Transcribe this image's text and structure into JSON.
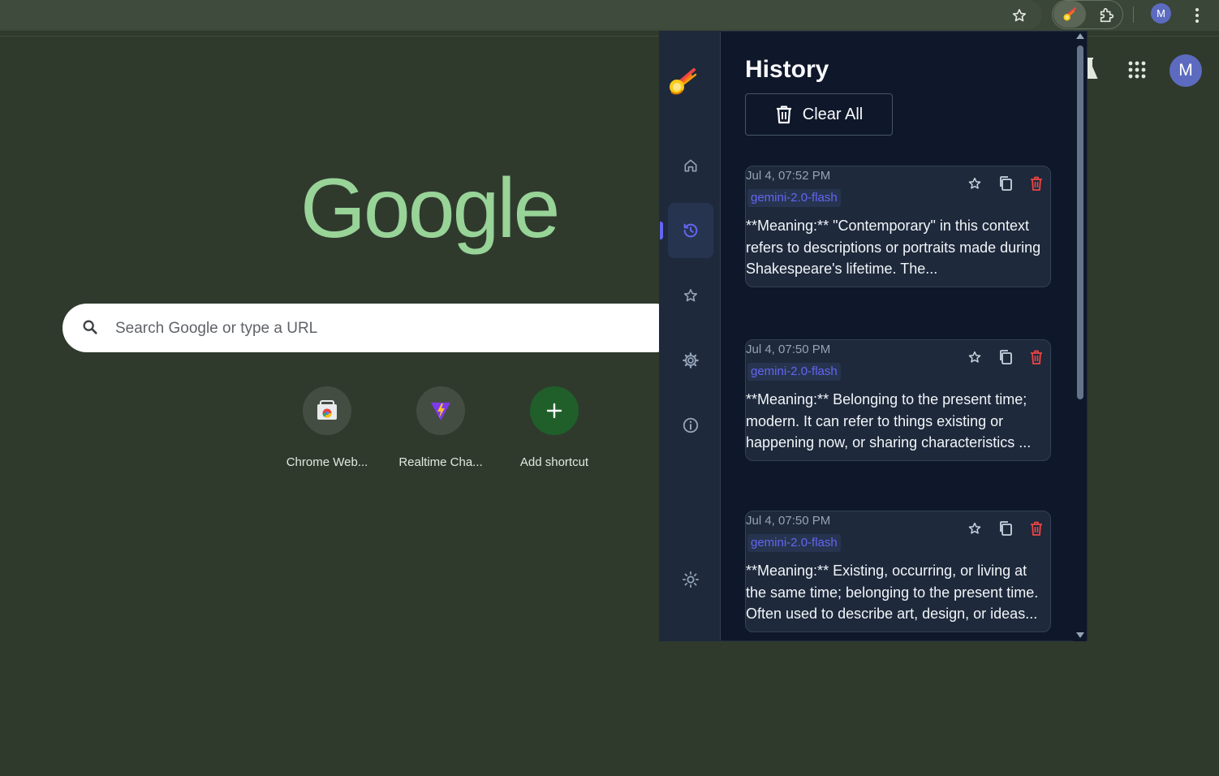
{
  "browser": {
    "icons": [
      "star-icon",
      "extension-active-icon",
      "puzzle-icon",
      "profile-avatar",
      "more-icon"
    ],
    "profile_initial": "M"
  },
  "ntp": {
    "logo": "Google",
    "search_placeholder": "Search Google or type a URL",
    "shortcuts": [
      {
        "label": "Chrome Web..."
      },
      {
        "label": "Realtime Cha..."
      },
      {
        "label": "Add shortcut"
      }
    ],
    "avatar_initial": "M"
  },
  "popup": {
    "title": "History",
    "clear_label": "Clear All",
    "nav": [
      "home-icon",
      "history-icon",
      "favorites-icon",
      "settings-icon",
      "info-icon",
      "theme-icon"
    ],
    "active_nav": "history",
    "items": [
      {
        "time": "Jul 4, 07:52 PM",
        "model": "gemini-2.0-flash",
        "text": "**Meaning:** \"Contemporary\" in this context refers to descriptions or portraits made during Shakespeare's lifetime. The..."
      },
      {
        "time": "Jul 4, 07:50 PM",
        "model": "gemini-2.0-flash",
        "text": "**Meaning:** Belonging to the present time; modern. It can refer to things existing or happening now, or sharing characteristics ..."
      },
      {
        "time": "Jul 4, 07:50 PM",
        "model": "gemini-2.0-flash",
        "text": "**Meaning:** Existing, occurring, or living at the same time; belonging to the present time. Often used to describe art, design, or ideas..."
      }
    ]
  },
  "colors": {
    "accent": "#6366f1",
    "delete": "#ef4444",
    "panel_bg": "#0f172a",
    "rail_bg": "#1e293b"
  }
}
